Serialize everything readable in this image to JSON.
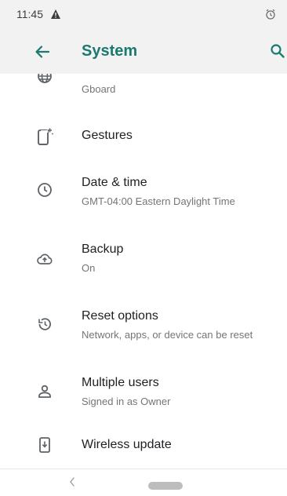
{
  "status_bar": {
    "time": "11:45"
  },
  "app_bar": {
    "title": "System"
  },
  "items": [
    {
      "id": "languages",
      "label": "",
      "subtitle": "Gboard"
    },
    {
      "id": "gestures",
      "label": "Gestures",
      "subtitle": ""
    },
    {
      "id": "date-time",
      "label": "Date & time",
      "subtitle": "GMT-04:00 Eastern Daylight Time"
    },
    {
      "id": "backup",
      "label": "Backup",
      "subtitle": "On"
    },
    {
      "id": "reset",
      "label": "Reset options",
      "subtitle": "Network, apps, or device can be reset"
    },
    {
      "id": "users",
      "label": "Multiple users",
      "subtitle": "Signed in as Owner"
    },
    {
      "id": "wireless-update",
      "label": "Wireless update",
      "subtitle": ""
    }
  ],
  "colors": {
    "accent": "#1a7a6e",
    "bar_bg": "#f2f2f2",
    "icon": "#5f6368"
  }
}
